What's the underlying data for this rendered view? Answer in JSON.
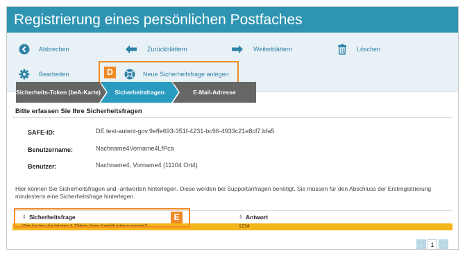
{
  "window": {
    "title": "Registrierung eines persönlichen Postfaches"
  },
  "toolbar": {
    "cancel_label": "Abbrechen",
    "back_label": "Zurückblättern",
    "forward_label": "Weiterblättern",
    "delete_label": "Löschen",
    "edit_label": "Bearbeiten",
    "new_question_label": "Neue Sicherheitsfrage anlegen"
  },
  "callouts": {
    "d": "D",
    "e": "E"
  },
  "steps": {
    "step1": "Sicherheits-Token (beA-Karte)",
    "step2": "Sicherheitsfragen",
    "step3": "E-Mail-Adresse"
  },
  "section": {
    "title": "Bitte erfassen Sie Ihre Sicherheitsfragen"
  },
  "fields": {
    "safe_id_label": "SAFE-ID:",
    "safe_id_value": "DE.test-autent-gov.9effe693-351f-4231-bc96-4933c21e8cf7.bfa5",
    "username_label": "Benutzername:",
    "username_value": "Nachname4Vorname4LfPca",
    "user_label": "Benutzer:",
    "user_value": "Nachname4, Vorname4 (11104 Ort4)"
  },
  "info_text": "Hier können Sie Sicherheitsfragen und -antworten hinterlegen. Diese werden bei Supportanfragen benötigt. Sie müssen für den Abschluss der Erstregistrierung mindestens eine Sicherheitsfrage hinterlegen.",
  "grid": {
    "col_question": "Sicherheitsfrage",
    "col_answer": "Antwort",
    "rows": [
      {
        "question": "Wie lauten die letzten 4 Ziffern Ihrer Kreditkartennummer?",
        "answer": "1234"
      }
    ]
  },
  "pager": {
    "current_page": "1",
    "prev_icon": "chevron-left-icon",
    "next_icon": "chevron-right-icon"
  },
  "colors": {
    "accent": "#2f94b2",
    "highlight": "#f08a24",
    "selected_row": "#f4b51b"
  }
}
